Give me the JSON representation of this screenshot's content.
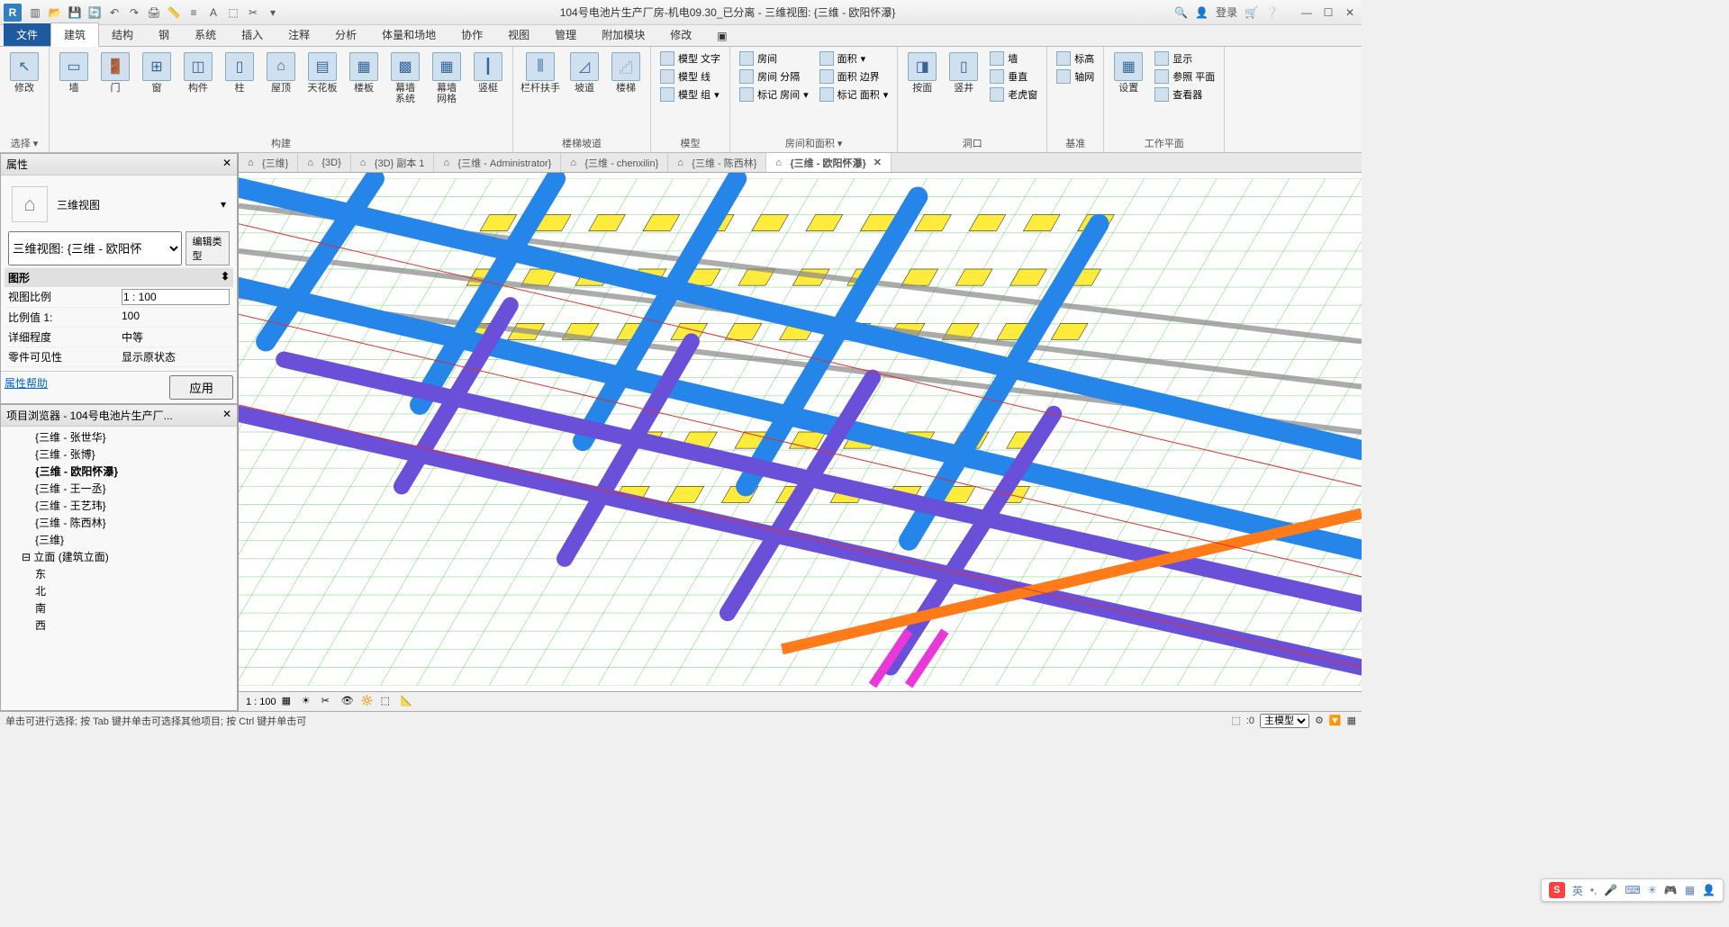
{
  "titlebar": {
    "title": "104号电池片生产厂房-机电09.30_已分离 - 三维视图: {三维 - 欧阳怀瀑}",
    "login": "登录"
  },
  "menu": {
    "file": "文件",
    "tabs": [
      "建筑",
      "结构",
      "钢",
      "系统",
      "插入",
      "注释",
      "分析",
      "体量和场地",
      "协作",
      "视图",
      "管理",
      "附加模块",
      "修改"
    ]
  },
  "ribbon": {
    "select_group": "选择",
    "modify": "修改",
    "build_group": "构建",
    "wall": "墙",
    "door": "门",
    "window": "窗",
    "component": "构件",
    "column": "柱",
    "roof": "屋顶",
    "ceiling": "天花板",
    "floor": "楼板",
    "curtain_system": "幕墙\n系统",
    "curtain_grid": "幕墙\n网格",
    "mullion": "竖梃",
    "circ_group": "楼梯坡道",
    "railing": "栏杆扶手",
    "ramp": "坡道",
    "stair": "楼梯",
    "model_group": "模型",
    "model_text": "模型 文字",
    "model_line": "模型 线",
    "model_group_btn": "模型 组",
    "room_area_group": "房间和面积",
    "room": "房间",
    "room_sep": "房间 分隔",
    "tag_room": "标记 房间",
    "area": "面积",
    "area_b": "面积 边界",
    "tag_area": "标记 面积",
    "opening_group": "洞口",
    "by_face": "按面",
    "shaft": "竖井",
    "wall_op": "墙",
    "vertical": "垂直",
    "dormer": "老虎窗",
    "datum_group": "基准",
    "level": "标高",
    "grid": "轴网",
    "wp_group": "工作平面",
    "set": "设置",
    "show": "显示",
    "ref_plane": "参照 平面",
    "viewer": "查看器"
  },
  "properties": {
    "title": "属性",
    "viewtype": "三维视图",
    "selector": "三维视图: {三维 - 欧阳怀",
    "edit_type": "编辑类型",
    "graphics": "图形",
    "view_scale_label": "视图比例",
    "view_scale": "1 : 100",
    "scale_value_label": "比例值 1:",
    "scale_value": "100",
    "detail_level_label": "详细程度",
    "detail_level": "中等",
    "parts_vis_label": "零件可见性",
    "parts_vis": "显示原状态",
    "help": "属性帮助",
    "apply": "应用"
  },
  "browser": {
    "title": "项目浏览器 - 104号电池片生产厂...",
    "items": [
      "{三维 - 张世华}",
      "{三维 - 张博}",
      "{三维 - 欧阳怀瀑}",
      "{三维 - 王一丞}",
      "{三维 - 王艺玮}",
      "{三维 - 陈西林}",
      "{三维}"
    ],
    "elev_group": "立面 (建筑立面)",
    "elev_items": [
      "东",
      "北",
      "南",
      "西"
    ]
  },
  "viewtabs": [
    "{三维}",
    "{3D}",
    "{3D} 副本 1",
    "{三维 - Administrator}",
    "{三维 - chenxilin}",
    "{三维 - 陈西林}",
    "{三维 - 欧阳怀瀑}"
  ],
  "viewctrl": {
    "scale": "1 : 100"
  },
  "statusbar": {
    "msg": "单击可进行选择; 按 Tab 键并单击可选择其他项目; 按 Ctrl 键并单击可",
    "model": "主模型",
    "zero": ":0"
  },
  "ime": {
    "lang": "英"
  }
}
